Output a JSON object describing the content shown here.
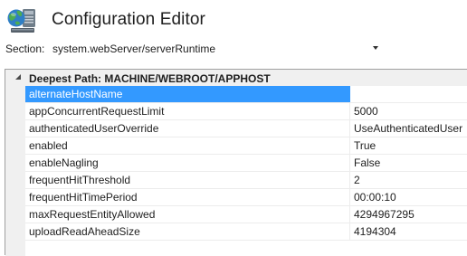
{
  "header": {
    "title": "Configuration Editor",
    "icon": "configuration-editor-icon"
  },
  "section": {
    "label": "Section:",
    "value": "system.webServer/serverRuntime"
  },
  "grid": {
    "group_title": "Deepest Path: MACHINE/WEBROOT/APPHOST",
    "collapse_icon": "collapse-triangle-icon",
    "selected_property": "alternateHostName",
    "properties": [
      {
        "name": "alternateHostName",
        "value": ""
      },
      {
        "name": "appConcurrentRequestLimit",
        "value": "5000"
      },
      {
        "name": "authenticatedUserOverride",
        "value": "UseAuthenticatedUser"
      },
      {
        "name": "enabled",
        "value": "True"
      },
      {
        "name": "enableNagling",
        "value": "False"
      },
      {
        "name": "frequentHitThreshold",
        "value": "2"
      },
      {
        "name": "frequentHitTimePeriod",
        "value": "00:00:10"
      },
      {
        "name": "maxRequestEntityAllowed",
        "value": "4294967295"
      },
      {
        "name": "uploadReadAheadSize",
        "value": "4194304"
      }
    ]
  },
  "colors": {
    "selection": "#3399ff",
    "group_background": "#f0f0f0",
    "grid_line": "#ececec"
  }
}
